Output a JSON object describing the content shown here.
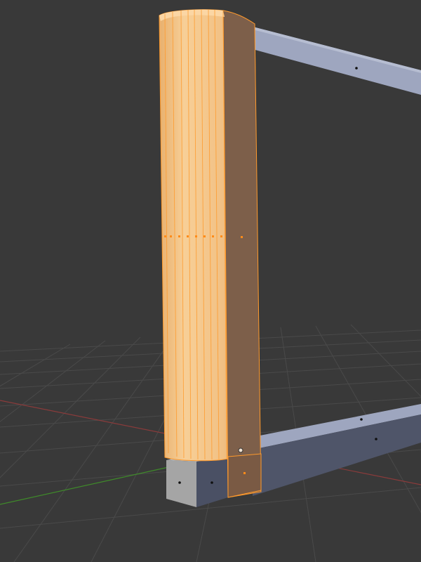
{
  "viewport": {
    "background": "#393939",
    "grid_color": "#4a4a4a",
    "axis_x_color": "#8a3b3b",
    "axis_y_color": "#3f8a2a"
  },
  "frame": {
    "top_color": "#9ea6bf",
    "side_color": "#4f5569",
    "end_face_color": "#a5a5a5",
    "vertex_color": "#0f0f0f"
  },
  "selection": {
    "fill_light": "#f6c489",
    "fill_mid": "#e4a867",
    "fill_side": "#7d5f4a",
    "edge_color": "#ff9a2c",
    "selected_vertex_color": "#ff8c1a",
    "pivot_icon": "origin-circle-icon"
  }
}
